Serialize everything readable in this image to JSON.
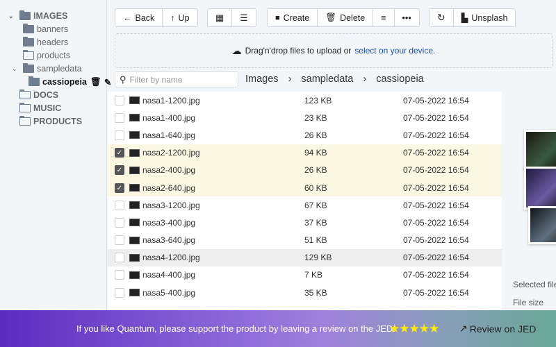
{
  "sidebar": {
    "items": [
      {
        "label": "IMAGES",
        "level": 0,
        "expanded": true,
        "folder": "filled"
      },
      {
        "label": "banners",
        "level": 1,
        "folder": "filled"
      },
      {
        "label": "headers",
        "level": 1,
        "folder": "filled"
      },
      {
        "label": "products",
        "level": 1,
        "folder": "outline"
      },
      {
        "label": "sampledata",
        "level": 1,
        "expanded": true,
        "folder": "filled"
      },
      {
        "label": "cassiopeia",
        "level": 2,
        "folder": "filled",
        "active": true
      },
      {
        "label": "DOCS",
        "level": 0,
        "folder": "outline"
      },
      {
        "label": "MUSIC",
        "level": 0,
        "folder": "outline"
      },
      {
        "label": "PRODUCTS",
        "level": 0,
        "folder": "outline"
      }
    ]
  },
  "toolbar": {
    "back": "Back",
    "up": "Up",
    "create": "Create",
    "delete": "Delete",
    "unsplash": "Unsplash"
  },
  "upload": {
    "text": "Drag'n'drop files to upload or",
    "link": "select on your device."
  },
  "filter": {
    "placeholder": "Filter by name"
  },
  "breadcrumb": [
    "Images",
    "sampledata",
    "cassiopeia"
  ],
  "files": [
    {
      "name": "nasa1-1200.jpg",
      "size": "123 KB",
      "date": "07-05-2022 16:54",
      "selected": false
    },
    {
      "name": "nasa1-400.jpg",
      "size": "23 KB",
      "date": "07-05-2022 16:54",
      "selected": false
    },
    {
      "name": "nasa1-640.jpg",
      "size": "26 KB",
      "date": "07-05-2022 16:54",
      "selected": false
    },
    {
      "name": "nasa2-1200.jpg",
      "size": "94 KB",
      "date": "07-05-2022 16:54",
      "selected": true
    },
    {
      "name": "nasa2-400.jpg",
      "size": "26 KB",
      "date": "07-05-2022 16:54",
      "selected": true
    },
    {
      "name": "nasa2-640.jpg",
      "size": "60 KB",
      "date": "07-05-2022 16:54",
      "selected": true
    },
    {
      "name": "nasa3-1200.jpg",
      "size": "67 KB",
      "date": "07-05-2022 16:54",
      "selected": false
    },
    {
      "name": "nasa3-400.jpg",
      "size": "37 KB",
      "date": "07-05-2022 16:54",
      "selected": false
    },
    {
      "name": "nasa3-640.jpg",
      "size": "51 KB",
      "date": "07-05-2022 16:54",
      "selected": false
    },
    {
      "name": "nasa4-1200.jpg",
      "size": "129 KB",
      "date": "07-05-2022 16:54",
      "selected": false,
      "hover": true
    },
    {
      "name": "nasa4-400.jpg",
      "size": "7 KB",
      "date": "07-05-2022 16:54",
      "selected": false
    },
    {
      "name": "nasa5-400.jpg",
      "size": "35 KB",
      "date": "07-05-2022 16:54",
      "selected": false
    }
  ],
  "preview": {
    "selected_label": "Selected file",
    "size_label": "File size"
  },
  "banner": {
    "text": "If you like Quantum, please support the product by leaving a review on the JED.",
    "stars": "★★★★★",
    "review": "Review on JED"
  }
}
